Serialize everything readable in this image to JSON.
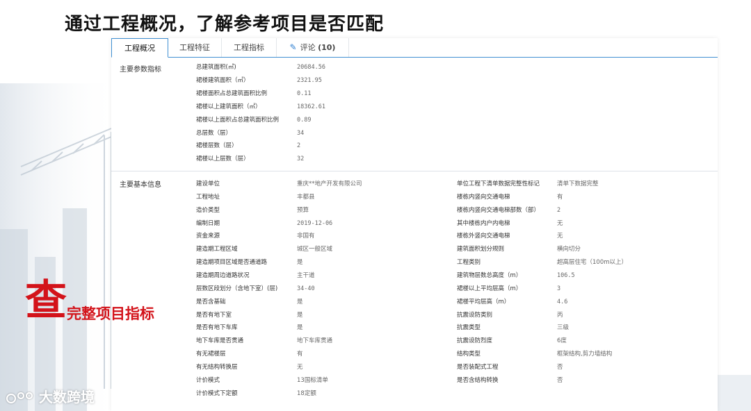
{
  "title": "通过工程概况，了解参考项目是否匹配",
  "tabs": [
    {
      "label": "工程概况",
      "active": true
    },
    {
      "label": "工程特征"
    },
    {
      "label": "工程指标"
    },
    {
      "label": "评论",
      "count": "(10)",
      "icon": "pencil-icon"
    }
  ],
  "params": {
    "section_label": "主要参数指标",
    "rows": [
      {
        "label": "总建筑面积(㎡)",
        "value": "20684.56"
      },
      {
        "label": "裙楼建筑面积（㎡）",
        "value": "2321.95"
      },
      {
        "label": "裙楼面积占总建筑面积比例",
        "value": "0.11"
      },
      {
        "label": "裙楼以上建筑面积（㎡）",
        "value": "18362.61"
      },
      {
        "label": "裙楼以上面积占总建筑面积比例",
        "value": "0.89"
      },
      {
        "label": "总层数（层）",
        "value": "34"
      },
      {
        "label": "裙楼层数（层）",
        "value": "2"
      },
      {
        "label": "裙楼以上层数（层）",
        "value": "32"
      }
    ]
  },
  "basic": {
    "section_label": "主要基本信息",
    "left": [
      {
        "label": "建设单位",
        "value": "重庆**地产开发有限公司"
      },
      {
        "label": "工程地址",
        "value": "丰都县"
      },
      {
        "label": "造价类型",
        "value": "预算"
      },
      {
        "label": "编制日期",
        "value": "2019-12-06"
      },
      {
        "label": "资金来源",
        "value": "非国有"
      },
      {
        "label": "建造期工程区域",
        "value": "城区一般区域"
      },
      {
        "label": "建造期项目区域是否通道路",
        "value": "是"
      },
      {
        "label": "建造期周边道路状况",
        "value": "主干道"
      },
      {
        "label": "层数区段划分（含地下室）(层)",
        "value": "34-40"
      },
      {
        "label": "是否含基础",
        "value": "是"
      },
      {
        "label": "是否有地下室",
        "value": "是"
      },
      {
        "label": "是否有地下车库",
        "value": "是"
      },
      {
        "label": "地下车库是否贯通",
        "value": "地下车库贯通"
      },
      {
        "label": "有无裙楼层",
        "value": "有"
      },
      {
        "label": "有无结构转换层",
        "value": "无"
      },
      {
        "label": "计价模式",
        "value": "13国标清单"
      },
      {
        "label": "计价模式下定额",
        "value": "18定额"
      }
    ],
    "right": [
      {
        "label": "单位工程下清单数据完整性标记",
        "value": "清单下数据完整"
      },
      {
        "label": "楼栋内竖向交通电梯",
        "value": "有"
      },
      {
        "label": "楼栋内竖向交通电梯部数（部）",
        "value": "2"
      },
      {
        "label": "其中楼栋内户内电梯",
        "value": "无"
      },
      {
        "label": "楼栋外竖向交通电梯",
        "value": "无"
      },
      {
        "label": "建筑面积划分规则",
        "value": "横向切分"
      },
      {
        "label": "工程类别",
        "value": "超高层住宅（100m以上）"
      },
      {
        "label": "建筑物层数总高度（m）",
        "value": "106.5"
      },
      {
        "label": "裙楼以上平均层高（m）",
        "value": "3"
      },
      {
        "label": "裙楼平均层高（m）",
        "value": "4.6"
      },
      {
        "label": "抗震设防类别",
        "value": "丙"
      },
      {
        "label": "抗震类型",
        "value": "三级"
      },
      {
        "label": "抗震设防烈度",
        "value": "6度"
      },
      {
        "label": "结构类型",
        "value": "框架结构,剪力墙结构"
      },
      {
        "label": "是否装配式工程",
        "value": "否"
      },
      {
        "label": "是否含结构转换",
        "value": "否"
      }
    ]
  },
  "callout": {
    "big": "查",
    "small": "完整项目指标"
  },
  "watermark": {
    "text": "大数跨境"
  },
  "colors": {
    "accent": "#3f8fd2",
    "callout": "#d3131a"
  }
}
